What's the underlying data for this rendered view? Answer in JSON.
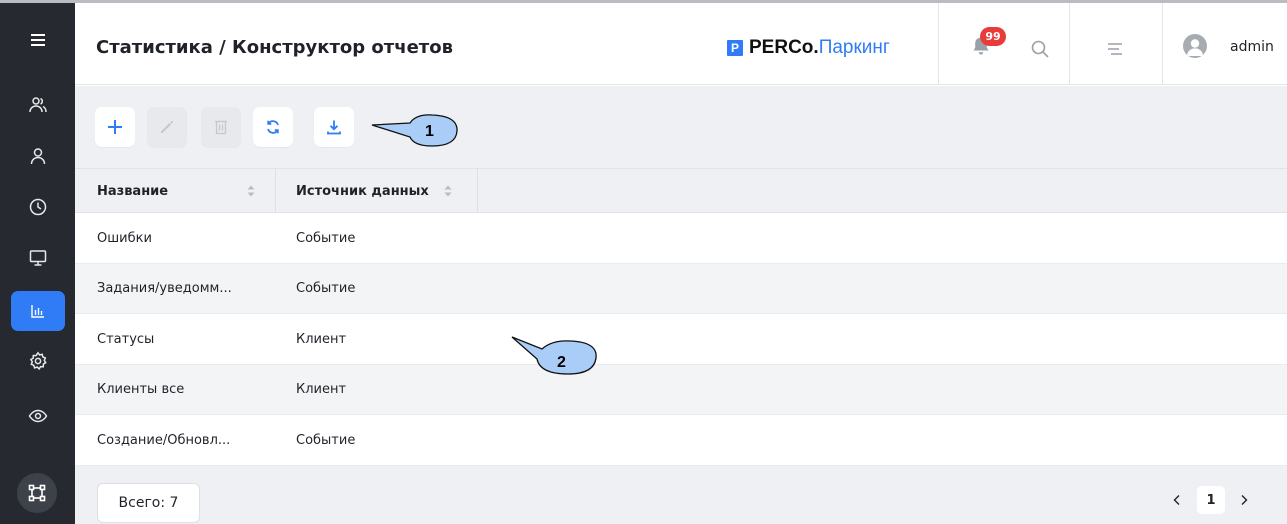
{
  "header": {
    "title": "Статистика / Конструктор отчетов",
    "brand_mark": "P",
    "brand_name": "PERCo.",
    "brand_product": "Паркинг",
    "notifications_count": "99",
    "username": "admin"
  },
  "sidebar": {
    "items": [
      {
        "icon": "menu-icon"
      },
      {
        "icon": "users-icon"
      },
      {
        "icon": "user-icon"
      },
      {
        "icon": "clock-icon"
      },
      {
        "icon": "monitor-icon"
      },
      {
        "icon": "chart-icon",
        "active": true
      },
      {
        "icon": "gear-icon"
      },
      {
        "icon": "eye-icon"
      }
    ],
    "bottom_icon": "frame-icon"
  },
  "toolbar": {
    "buttons": [
      {
        "icon": "plus-icon",
        "enabled": true
      },
      {
        "icon": "edit-icon",
        "enabled": false
      },
      {
        "icon": "trash-icon",
        "enabled": false
      },
      {
        "icon": "refresh-icon",
        "enabled": true
      },
      {
        "icon": "download-icon",
        "enabled": true
      }
    ]
  },
  "table": {
    "columns": [
      "Название",
      "Источник данных"
    ],
    "rows": [
      [
        "Ошибки",
        "Событие"
      ],
      [
        "Задания/уведомм...",
        "Событие"
      ],
      [
        "Статусы",
        "Клиент"
      ],
      [
        "Клиенты все",
        "Клиент"
      ],
      [
        "Создание/Обновл...",
        "Событие"
      ]
    ]
  },
  "footer": {
    "total": "Всего: 7",
    "current_page": "1"
  },
  "callouts": [
    "1",
    "2"
  ],
  "colors": {
    "accent": "#2f7cf6",
    "sidebar_bg": "#262a30",
    "badge": "#ea3b3b",
    "callout_fill": "#a9cdf6"
  }
}
